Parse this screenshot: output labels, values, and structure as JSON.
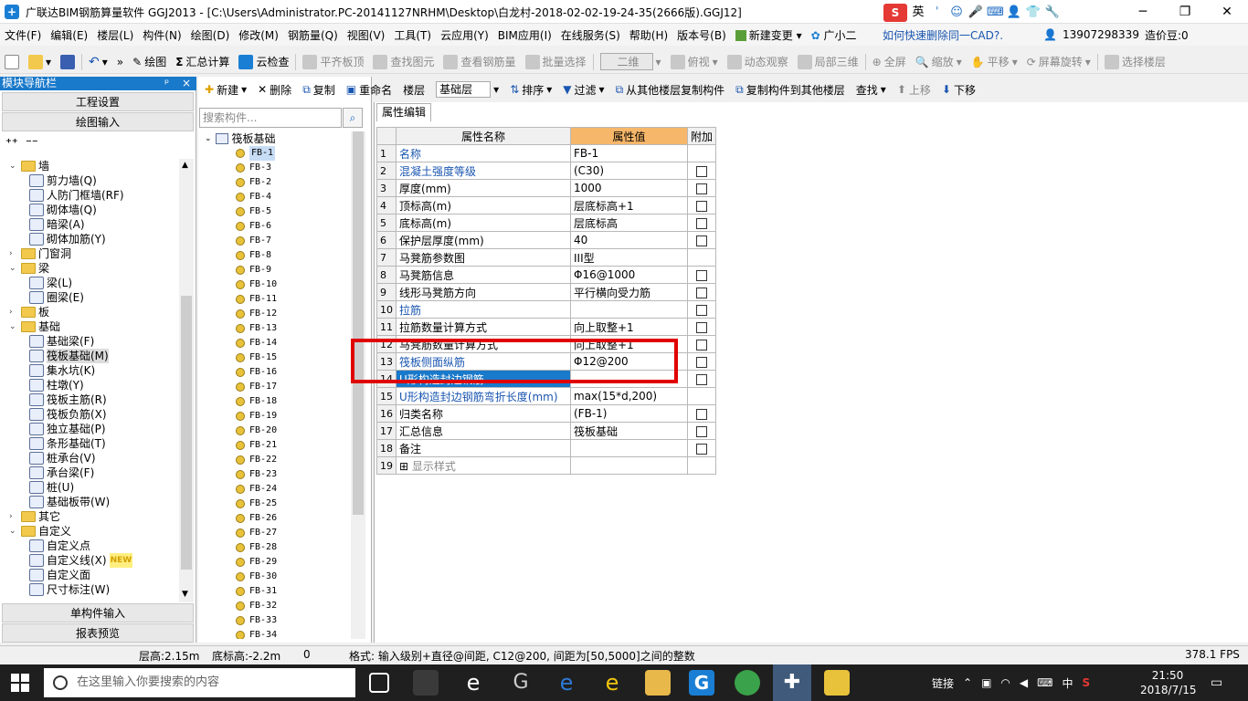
{
  "window": {
    "title": "广联达BIM钢筋算量软件 GGJ2013 - [C:\\Users\\Administrator.PC-20141127NRHM\\Desktop\\白龙村-2018-02-02-19-24-35(2666版).GGJ12]",
    "minimize": "─",
    "maximize": "❐",
    "close": "✕"
  },
  "ime": {
    "logo": "S",
    "lang": "英"
  },
  "menu": {
    "items": [
      "文件(F)",
      "编辑(E)",
      "楼层(L)",
      "构件(N)",
      "绘图(D)",
      "修改(M)",
      "钢筋量(Q)",
      "视图(V)",
      "工具(T)",
      "云应用(Y)",
      "BIM应用(I)",
      "在线服务(S)",
      "帮助(H)",
      "版本号(B)",
      "新建变更",
      "广小二"
    ],
    "tip": "如何快速删除同一CAD?.",
    "phone": "13907298339",
    "coins": "造价豆:0"
  },
  "toolbar1": {
    "draw": "绘图",
    "sum": "汇总计算",
    "cloud_check": "云检查",
    "align_top": "平齐板顶",
    "find_elem": "查找图元",
    "view_rebar": "查看钢筋量",
    "batch_select": "批量选择",
    "view_mode": "二维",
    "top_view": "俯视",
    "dynamic": "动态观察",
    "local_3d": "局部三维",
    "fullscreen": "全屏",
    "zoom": "缩放",
    "pan": "平移",
    "rotate": "屏幕旋转",
    "select_floor": "选择楼层"
  },
  "left_panel": {
    "header": "模块导航栏",
    "pin": "ᵖ",
    "close": "×",
    "project_settings": "工程设置",
    "draw_input": "绘图输入",
    "single_input": "单构件输入",
    "report_preview": "报表预览",
    "tree": [
      {
        "label": "墙",
        "level": 0,
        "exp": "⌄",
        "folder": true
      },
      {
        "label": "剪力墙(Q)",
        "level": 1
      },
      {
        "label": "人防门框墙(RF)",
        "level": 1
      },
      {
        "label": "砌体墙(Q)",
        "level": 1
      },
      {
        "label": "暗梁(A)",
        "level": 1
      },
      {
        "label": "砌体加筋(Y)",
        "level": 1
      },
      {
        "label": "门窗洞",
        "level": 0,
        "exp": "›",
        "folder": true
      },
      {
        "label": "梁",
        "level": 0,
        "exp": "⌄",
        "folder": true
      },
      {
        "label": "梁(L)",
        "level": 1
      },
      {
        "label": "圈梁(E)",
        "level": 1
      },
      {
        "label": "板",
        "level": 0,
        "exp": "›",
        "folder": true
      },
      {
        "label": "基础",
        "level": 0,
        "exp": "⌄",
        "folder": true
      },
      {
        "label": "基础梁(F)",
        "level": 1
      },
      {
        "label": "筏板基础(M)",
        "level": 1,
        "selected": true
      },
      {
        "label": "集水坑(K)",
        "level": 1
      },
      {
        "label": "柱墩(Y)",
        "level": 1
      },
      {
        "label": "筏板主筋(R)",
        "level": 1
      },
      {
        "label": "筏板负筋(X)",
        "level": 1
      },
      {
        "label": "独立基础(P)",
        "level": 1
      },
      {
        "label": "条形基础(T)",
        "level": 1
      },
      {
        "label": "桩承台(V)",
        "level": 1
      },
      {
        "label": "承台梁(F)",
        "level": 1
      },
      {
        "label": "桩(U)",
        "level": 1
      },
      {
        "label": "基础板带(W)",
        "level": 1
      },
      {
        "label": "其它",
        "level": 0,
        "exp": "›",
        "folder": true
      },
      {
        "label": "自定义",
        "level": 0,
        "exp": "⌄",
        "folder": true
      },
      {
        "label": "自定义点",
        "level": 1
      },
      {
        "label": "自定义线(X)",
        "level": 1,
        "badge": "NEW"
      },
      {
        "label": "自定义面",
        "level": 1
      },
      {
        "label": "尺寸标注(W)",
        "level": 1
      }
    ]
  },
  "mid_panel": {
    "search_placeholder": "搜索构件...",
    "root": "筏板基础",
    "items": [
      "FB-1",
      "FB-3",
      "FB-2",
      "FB-4",
      "FB-5",
      "FB-6",
      "FB-7",
      "FB-8",
      "FB-9",
      "FB-10",
      "FB-11",
      "FB-12",
      "FB-13",
      "FB-14",
      "FB-15",
      "FB-16",
      "FB-17",
      "FB-18",
      "FB-19",
      "FB-20",
      "FB-21",
      "FB-22",
      "FB-23",
      "FB-24",
      "FB-25",
      "FB-26",
      "FB-27",
      "FB-28",
      "FB-29",
      "FB-30",
      "FB-31",
      "FB-32",
      "FB-33",
      "FB-34"
    ]
  },
  "actionbar": {
    "new": "新建",
    "delete": "删除",
    "copy": "复制",
    "rename": "重命名",
    "floor_label": "楼层",
    "floor_value": "基础层",
    "sort": "排序",
    "filter": "过滤",
    "copy_from": "从其他楼层复制构件",
    "copy_to": "复制构件到其他楼层",
    "find": "查找",
    "up": "上移",
    "down": "下移"
  },
  "props": {
    "tab": "属性编辑",
    "headers": {
      "name": "属性名称",
      "value": "属性值",
      "extra": "附加"
    },
    "rows": [
      {
        "no": "1",
        "name": "名称",
        "value": "FB-1",
        "blue": true,
        "check": false
      },
      {
        "no": "2",
        "name": "混凝土强度等级",
        "value": "(C30)",
        "blue": true,
        "check": true
      },
      {
        "no": "3",
        "name": "厚度(mm)",
        "value": "1000",
        "check": true
      },
      {
        "no": "4",
        "name": "顶标高(m)",
        "value": "层底标高+1",
        "check": true
      },
      {
        "no": "5",
        "name": "底标高(m)",
        "value": "层底标高",
        "check": true
      },
      {
        "no": "6",
        "name": "保护层厚度(mm)",
        "value": "40",
        "check": true
      },
      {
        "no": "7",
        "name": "马凳筋参数图",
        "value": "III型",
        "check": false
      },
      {
        "no": "8",
        "name": "马凳筋信息",
        "value": "Φ16@1000",
        "check": true
      },
      {
        "no": "9",
        "name": "线形马凳筋方向",
        "value": "平行横向受力筋",
        "check": true
      },
      {
        "no": "10",
        "name": "拉筋",
        "value": "",
        "blue": true,
        "check": true
      },
      {
        "no": "11",
        "name": "拉筋数量计算方式",
        "value": "向上取整+1",
        "check": true
      },
      {
        "no": "12",
        "name": "马凳筋数量计算方式",
        "value": "向上取整+1",
        "check": true
      },
      {
        "no": "13",
        "name": "筏板侧面纵筋",
        "value": "Φ12@200",
        "blue": true,
        "check": true
      },
      {
        "no": "14",
        "name": "U形构造封边钢筋",
        "value": "",
        "check": true,
        "selected": true
      },
      {
        "no": "15",
        "name": "U形构造封边钢筋弯折长度(mm)",
        "value": "max(15*d,200)",
        "blue": true,
        "check": false
      },
      {
        "no": "16",
        "name": "归类名称",
        "value": "(FB-1)",
        "check": true
      },
      {
        "no": "17",
        "name": "汇总信息",
        "value": "筏板基础",
        "check": true
      },
      {
        "no": "18",
        "name": "备注",
        "value": "",
        "check": true
      },
      {
        "no": "19",
        "name": "显示样式",
        "value": "",
        "check": false,
        "plus": true
      }
    ]
  },
  "status": {
    "floor_height": "层高:2.15m",
    "base_height": "底标高:-2.2m",
    "zero": "0",
    "hint": "格式: 输入级别+直径@间距, C12@200, 间距为[50,5000]之间的整数",
    "fps": "378.1 FPS"
  },
  "taskbar": {
    "search": "在这里输入你要搜索的内容",
    "tray_link": "链接",
    "ime": "中",
    "time": "21:50",
    "date": "2018/7/15"
  }
}
